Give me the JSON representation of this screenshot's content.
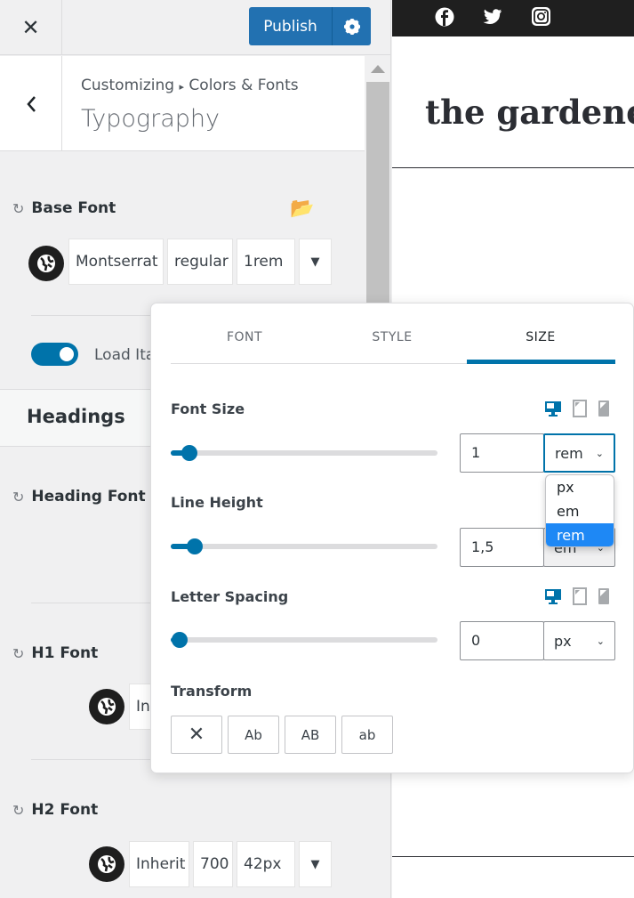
{
  "topbar": {
    "close_icon": "close-icon",
    "publish_label": "Publish",
    "settings_icon": "gear-icon"
  },
  "header": {
    "breadcrumb_root": "Customizing",
    "breadcrumb_sep": "▸",
    "breadcrumb_parent": "Colors & Fonts",
    "title": "Typography"
  },
  "base_font": {
    "label": "Base Font",
    "family": "Montserrat",
    "weight": "regular",
    "size": "1rem"
  },
  "load_italic": {
    "label": "Load Italic",
    "enabled": true
  },
  "headings": {
    "title": "Headings"
  },
  "heading_font_family": {
    "label": "Heading Font Family"
  },
  "h1_font": {
    "label": "H1 Font",
    "family": "Inherit"
  },
  "h2_font": {
    "label": "H2 Font",
    "family": "Inherit",
    "weight": "700",
    "size": "42px"
  },
  "preview": {
    "site_title": "the gardener",
    "social_icons": [
      "facebook-icon",
      "twitter-icon",
      "instagram-icon"
    ]
  },
  "popup": {
    "tabs": [
      "FONT",
      "STYLE",
      "SIZE"
    ],
    "active_tab": "SIZE",
    "font_size": {
      "label": "Font Size",
      "value": "1",
      "unit": "rem",
      "slider_fraction": 0.04
    },
    "unit_options": [
      "px",
      "em",
      "rem"
    ],
    "unit_selected": "rem",
    "line_height": {
      "label": "Line Height",
      "value": "1,5",
      "unit": "em",
      "slider_fraction": 0.06
    },
    "letter_spacing": {
      "label": "Letter Spacing",
      "value": "0",
      "unit": "px",
      "slider_fraction": 0.0
    },
    "transform": {
      "label": "Transform",
      "options": [
        "✕",
        "Ab",
        "AB",
        "ab"
      ]
    }
  },
  "colors": {
    "accent": "#0073aa",
    "publish": "#2271b1",
    "dropdown_highlight": "#1e88f5"
  }
}
